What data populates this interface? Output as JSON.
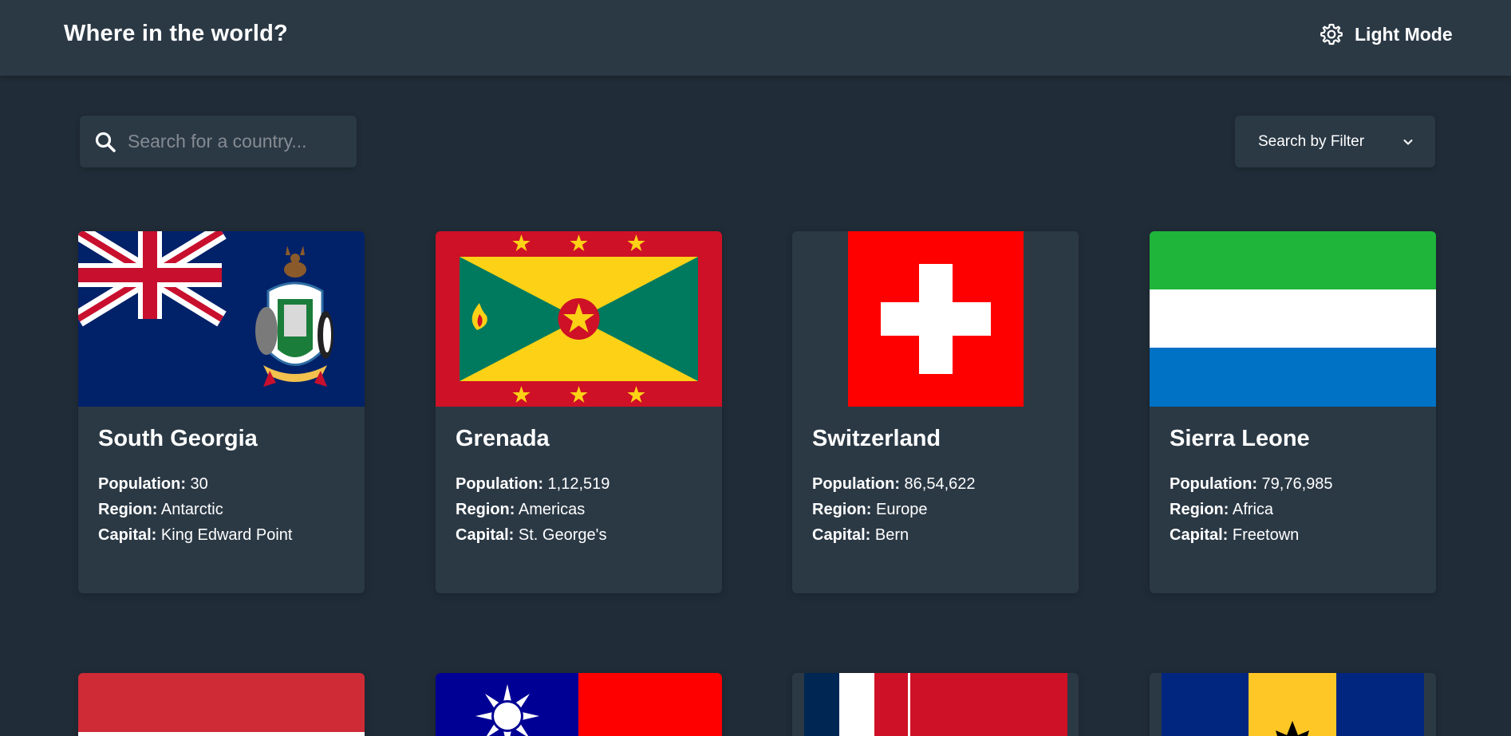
{
  "header": {
    "title": "Where in the world?",
    "mode_label": "Light Mode",
    "mode_icon": "gear-icon"
  },
  "search": {
    "placeholder": "Search for a country...",
    "value": "",
    "icon": "search-icon"
  },
  "filter": {
    "label": "Search by Filter",
    "icon": "chevron-down-icon"
  },
  "labels": {
    "population": "Population:",
    "region": "Region:",
    "capital": "Capital:"
  },
  "countries": [
    {
      "name": "South Georgia",
      "population": "30",
      "region": "Antarctic",
      "capital": "King Edward Point",
      "flag": "south-georgia-flag"
    },
    {
      "name": "Grenada",
      "population": "1,12,519",
      "region": "Americas",
      "capital": "St. George's",
      "flag": "grenada-flag"
    },
    {
      "name": "Switzerland",
      "population": "86,54,622",
      "region": "Europe",
      "capital": "Bern",
      "flag": "switzerland-flag"
    },
    {
      "name": "Sierra Leone",
      "population": "79,76,985",
      "region": "Africa",
      "capital": "Freetown",
      "flag": "sierra-leone-flag"
    }
  ],
  "partial_cards": [
    {
      "flag": "red-white-flag"
    },
    {
      "flag": "taiwan-flag"
    },
    {
      "flag": "saint-martin-flag"
    },
    {
      "flag": "barbados-flag"
    }
  ],
  "colors": {
    "background": "#202c37",
    "element": "#2b3945",
    "text": "#ffffff",
    "placeholder": "#858b92"
  }
}
